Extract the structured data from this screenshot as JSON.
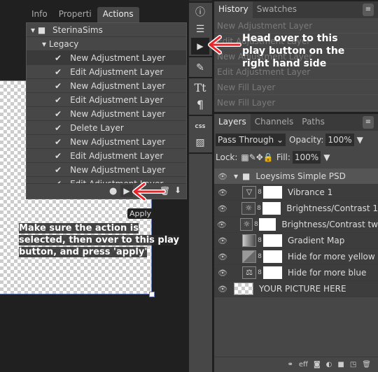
{
  "actions_panel": {
    "tabs": [
      "Info",
      "Properti",
      "Actions"
    ],
    "set": "SterinaSims",
    "action": "Legacy",
    "steps": [
      "New Adjustment Layer",
      "Edit Adjustment Layer",
      "New Adjustment Layer",
      "Edit Adjustment Layer",
      "New Adjustment Layer",
      "Delete Layer",
      "New Adjustment Layer",
      "Edit Adjustment Layer",
      "New Adjustment Layer",
      "Edit Adjustment Layer"
    ],
    "footer_icons": [
      "record-icon",
      "play-icon",
      "new-action-icon",
      "trash-icon",
      "download-icon"
    ],
    "tooltip": "Apply"
  },
  "toolbar": {
    "icons": [
      "info-icon",
      "adjustments-icon",
      "play-icon",
      "brush-preset-icon",
      "text-icon",
      "paragraph-icon",
      "css-icon",
      "image-icon"
    ],
    "css_label": "CSS"
  },
  "history_panel": {
    "tabs": [
      "History",
      "Swatches"
    ],
    "items": [
      "New Adjustment Layer",
      "Edit Adjustment Layer",
      "New Adjustment Layer",
      "Edit Adjustment Layer",
      "New Fill Layer",
      "New Fill Layer"
    ]
  },
  "layers_panel": {
    "tabs": [
      "Layers",
      "Channels",
      "Paths"
    ],
    "blend_mode": "Pass Through",
    "opacity_label": "Opacity:",
    "opacity": "100%",
    "lock_label": "Lock:",
    "fill_label": "Fill:",
    "fill": "100%",
    "group": "Loeysims Simple PSD",
    "layers": [
      {
        "name": "Vibrance 1",
        "icon": "▽"
      },
      {
        "name": "Brightness/Contrast 1",
        "icon": "☼"
      },
      {
        "name": "Brightness/Contrast tw",
        "icon": "☼"
      },
      {
        "name": "Gradient Map",
        "icon": ""
      },
      {
        "name": "Hide for more yellow",
        "icon": ""
      },
      {
        "name": "Hide for more blue",
        "icon": "⚖"
      }
    ],
    "base_layer": "YOUR PICTURE HERE",
    "footer_icons": [
      "link-icon",
      "effects-icon",
      "mask-icon",
      "adjustment-icon",
      "folder-icon",
      "new-layer-icon",
      "trash-icon"
    ],
    "eff_label": "eff"
  },
  "annotations": {
    "top": "Head over to this play button on the right hand side",
    "bottom": "Make sure the action is selected, then over to this play button, and press 'apply'",
    "arrow_color": "#e8242a"
  }
}
